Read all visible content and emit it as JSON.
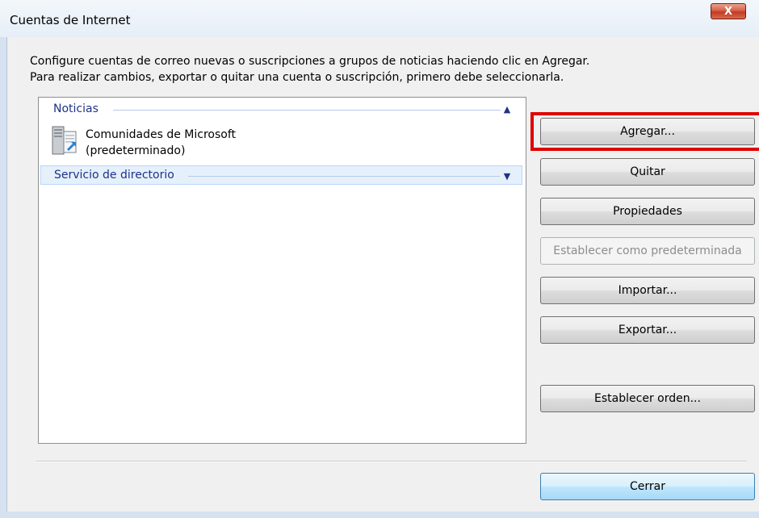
{
  "window": {
    "title": "Cuentas de Internet",
    "close_glyph": "X"
  },
  "description": {
    "line1": "Configure cuentas de correo nuevas o suscripciones a grupos de noticias haciendo clic en Agregar.",
    "line2": "Para realizar cambios, exportar o quitar una cuenta o suscripción, primero debe seleccionarla."
  },
  "accounts": {
    "groups": [
      {
        "label": "Noticias",
        "state": "expanded",
        "items": [
          {
            "name": "Comunidades de Microsoft",
            "detail": "(predeterminado)",
            "icon": "news-server-icon"
          }
        ]
      },
      {
        "label": "Servicio de directorio",
        "state": "collapsed",
        "items": []
      }
    ]
  },
  "buttons": {
    "add": "Agregar...",
    "remove": "Quitar",
    "properties": "Propiedades",
    "set_default": "Establecer como predeterminada",
    "import": "Importar...",
    "export": "Exportar...",
    "set_order": "Establecer orden...",
    "close": "Cerrar"
  },
  "annotation": {
    "highlight_color": "#e00000",
    "highlighted": "add"
  }
}
